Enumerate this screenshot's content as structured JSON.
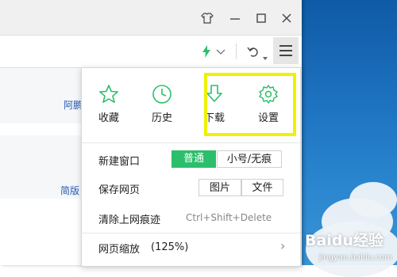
{
  "browser": {
    "side_links": [
      "阿鹏",
      "简版"
    ]
  },
  "menu": {
    "quick_actions": [
      {
        "label": "收藏",
        "icon": "star-icon"
      },
      {
        "label": "历史",
        "icon": "clock-icon"
      },
      {
        "label": "下载",
        "icon": "download-icon"
      },
      {
        "label": "设置",
        "icon": "gear-icon"
      }
    ],
    "new_window": {
      "label": "新建窗口",
      "options": [
        "普通",
        "小号/无痕"
      ],
      "selected": "普通"
    },
    "save_page": {
      "label": "保存网页",
      "options": [
        "图片",
        "文件"
      ]
    },
    "clear_traces": {
      "label": "清除上网痕迹",
      "shortcut": "Ctrl+Shift+Delete"
    },
    "zoom": {
      "label": "网页缩放",
      "value": "(125%)",
      "arrow": "›"
    }
  },
  "colors": {
    "accent_green": "#2bbf6b",
    "highlight": "#f0f000",
    "link_blue": "#2b59b5"
  },
  "watermark": {
    "text": "Baidu经验",
    "url": "jingyan.baidu.com"
  }
}
